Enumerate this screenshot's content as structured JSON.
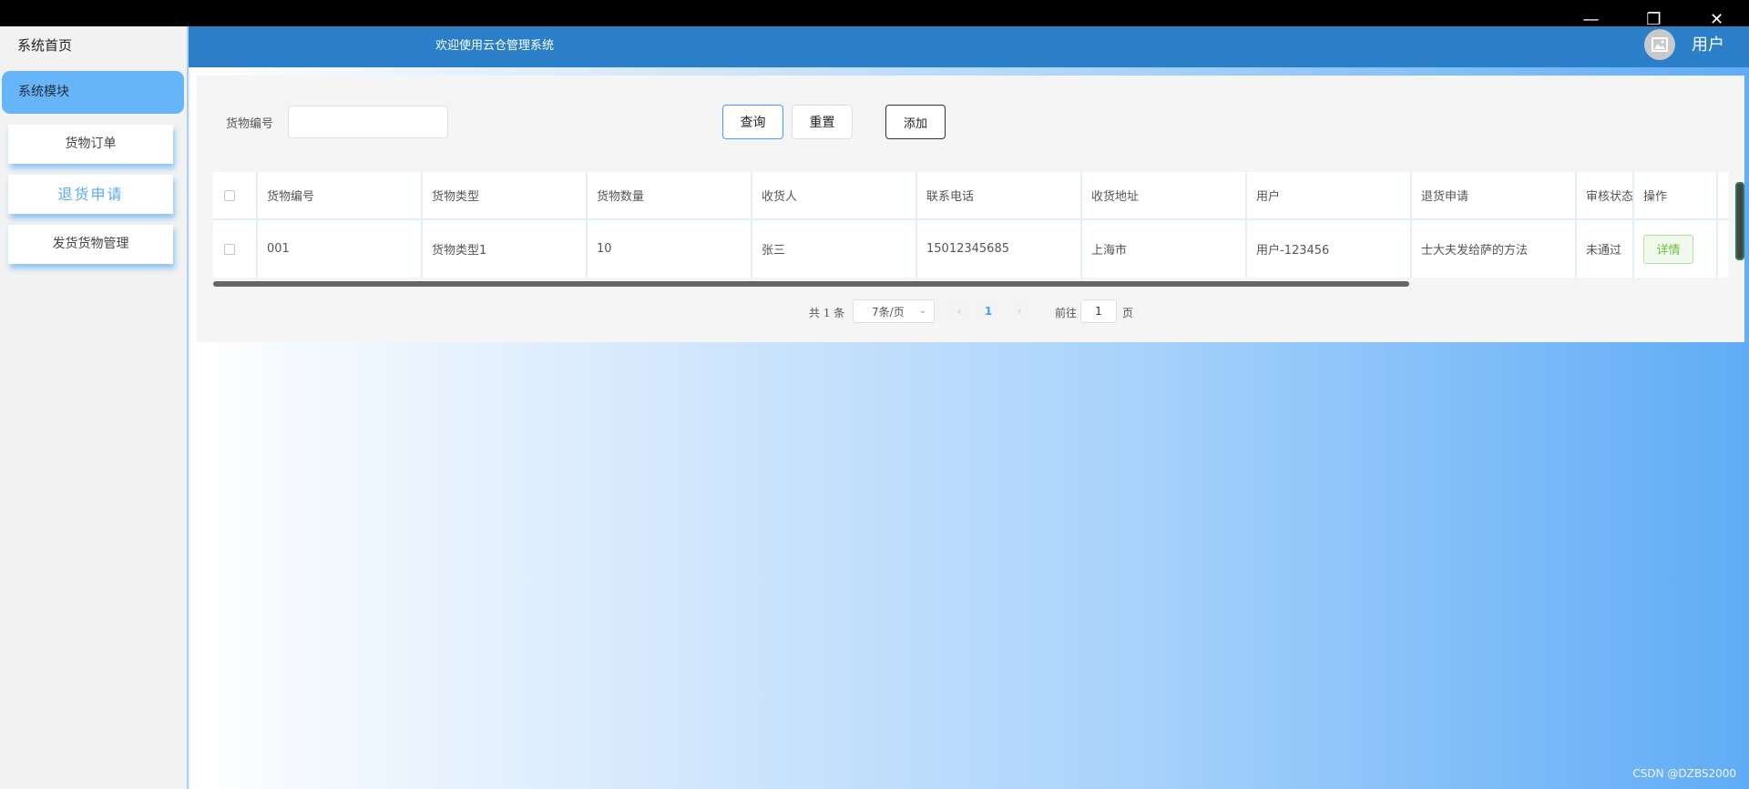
{
  "window_controls": {
    "minimize": "—",
    "restore": "❐",
    "close": "✕"
  },
  "sidebar": {
    "home": "系统首页",
    "module": "系统模块",
    "items": [
      {
        "label": "货物订单",
        "active": false
      },
      {
        "label": "退货申请",
        "active": true
      },
      {
        "label": "发货货物管理",
        "active": false
      }
    ]
  },
  "header": {
    "title": "欢迎使用云仓管理系统",
    "user": "用户",
    "avatar_icon": "image-icon"
  },
  "search": {
    "label": "货物编号",
    "value": "",
    "placeholder": "",
    "query_label": "查询",
    "reset_label": "重置",
    "add_label": "添加"
  },
  "table": {
    "headers": [
      "",
      "货物编号",
      "货物类型",
      "货物数量",
      "收货人",
      "联系电话",
      "收货地址",
      "用户",
      "退货申请",
      "审核状态",
      "操作"
    ],
    "rows": [
      [
        "",
        "001",
        "货物类型1",
        "10",
        "张三",
        "15012345685",
        "上海市",
        "用户-123456",
        "士大夫发给萨的方法",
        "未通过",
        "详情"
      ]
    ]
  },
  "pagination": {
    "total": "共 1 条",
    "page_size": "7条/页",
    "current_page": "1",
    "goto_label": "前往",
    "goto_value": "1",
    "unit": "页"
  },
  "watermark": "CSDN @DZBS2000",
  "colors": {
    "header": "#2b7fc9",
    "accent": "#409eff",
    "sidebar_active": "#66b5f8",
    "detail_btn": "#67c23a"
  }
}
